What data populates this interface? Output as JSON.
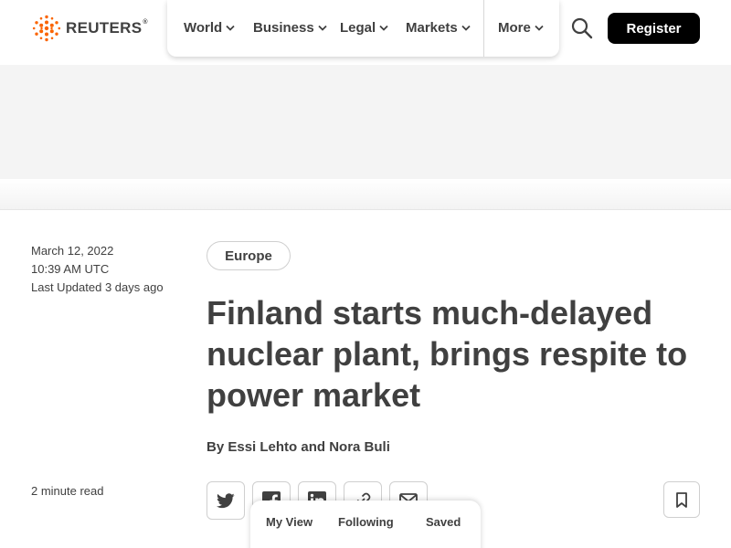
{
  "brand": {
    "name": "REUTERS",
    "trademark": "®",
    "accent_color": "#fa6400"
  },
  "nav": {
    "items": [
      {
        "label": "World"
      },
      {
        "label": "Business"
      },
      {
        "label": "Legal"
      },
      {
        "label": "Markets"
      }
    ],
    "more_label": "More"
  },
  "header": {
    "search_icon": "search-icon",
    "register_label": "Register"
  },
  "article": {
    "date": "March 12, 2022",
    "time": "10:39 AM UTC",
    "last_updated": "Last Updated 3 days ago",
    "tag": "Europe",
    "headline": "Finland starts much-delayed nuclear plant, brings respite to power market",
    "byline": "By Essi Lehto and Nora Buli",
    "read_time": "2 minute read",
    "share_icons": [
      "twitter-icon",
      "facebook-icon",
      "linkedin-icon",
      "link-icon",
      "email-icon"
    ],
    "bookmark_icon": "bookmark-icon"
  },
  "bottom_bar": {
    "tabs": [
      {
        "label": "My View"
      },
      {
        "label": "Following"
      },
      {
        "label": "Saved"
      }
    ]
  }
}
